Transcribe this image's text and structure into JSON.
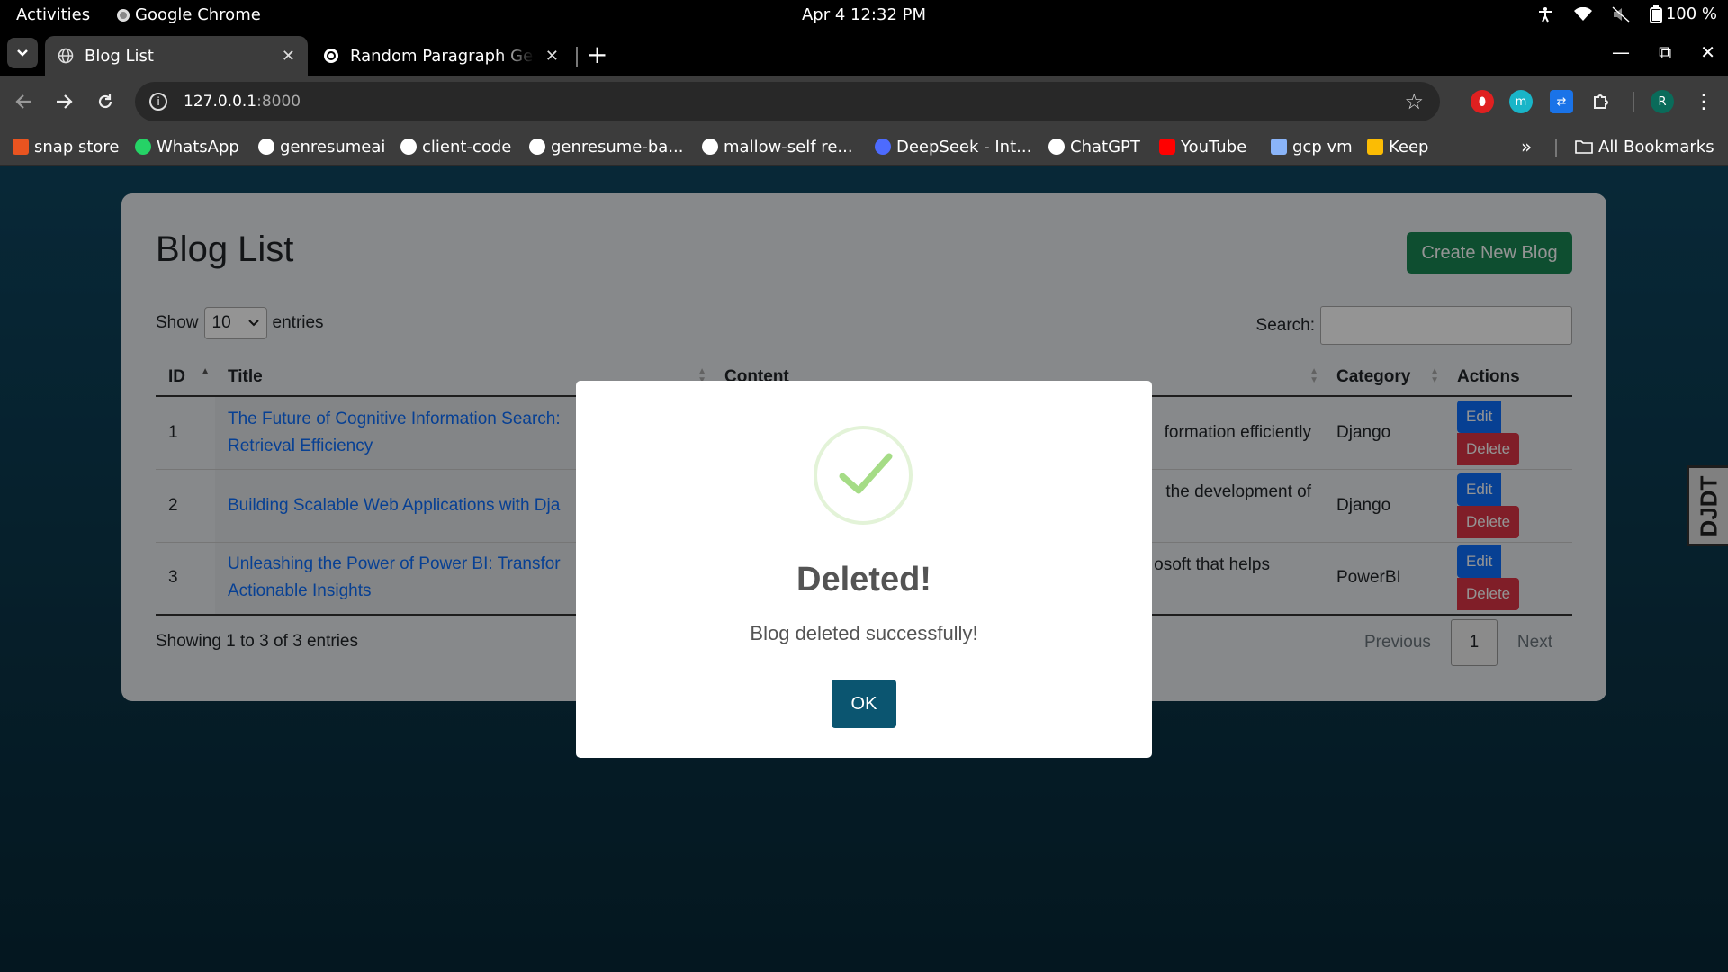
{
  "os": {
    "activities": "Activities",
    "app_name": "Google Chrome",
    "clock": "Apr 4  12:32 PM",
    "battery": "100 %"
  },
  "browser": {
    "tabs": [
      {
        "label": "Blog List",
        "active": true
      },
      {
        "label": "Random Paragraph Gene",
        "active": false
      }
    ],
    "url_host": "127.0.0.1",
    "url_port": ":8000",
    "profile_initial": "R",
    "ext_initial": "m",
    "bookmarks": [
      {
        "label": "snap store",
        "icon": "snap-icon",
        "color": "#e95420"
      },
      {
        "label": "WhatsApp",
        "icon": "whatsapp-icon",
        "color": "#25d366"
      },
      {
        "label": "genresumeai",
        "icon": "github-icon",
        "color": "#ffffff"
      },
      {
        "label": "client-code",
        "icon": "github-icon",
        "color": "#ffffff"
      },
      {
        "label": "genresume-ba...",
        "icon": "github-icon",
        "color": "#ffffff"
      },
      {
        "label": "mallow-self re...",
        "icon": "github-icon",
        "color": "#ffffff"
      },
      {
        "label": "DeepSeek - Int...",
        "icon": "deepseek-icon",
        "color": "#4d6bfe"
      },
      {
        "label": "ChatGPT",
        "icon": "chatgpt-icon",
        "color": "#ffffff"
      },
      {
        "label": "YouTube",
        "icon": "youtube-icon",
        "color": "#ff0000"
      },
      {
        "label": "gcp vm",
        "icon": "gcp-icon",
        "color": "#8ab4f8"
      },
      {
        "label": "Keep",
        "icon": "keep-icon",
        "color": "#fbbc04"
      }
    ],
    "more_bookmarks": "»",
    "all_bookmarks": "All Bookmarks"
  },
  "page": {
    "title": "Blog List",
    "create_button": "Create New Blog",
    "show_label": "Show",
    "entries_value": "10",
    "entries_label": "entries",
    "search_label": "Search:",
    "columns": [
      "ID",
      "Title",
      "Content",
      "Category",
      "Actions"
    ],
    "rows": [
      {
        "id": "1",
        "title_l1": "The Future of Cognitive Information Search:",
        "title_l2": "Retrieval Efficiency",
        "content": "formation efficiently",
        "category": "Django"
      },
      {
        "id": "2",
        "title_l1": "Building Scalable Web Applications with Dja",
        "title_l2": "",
        "content": "the development of",
        "category": "Django"
      },
      {
        "id": "3",
        "title_l1": "Unleashing the Power of Power BI: Transfor",
        "title_l2": "Actionable Insights",
        "content": "osoft that helps",
        "category": "PowerBI"
      }
    ],
    "edit_label": "Edit",
    "delete_label": "Delete",
    "showing_info": "Showing 1 to 3 of 3 entries",
    "prev_label": "Previous",
    "current_page": "1",
    "next_label": "Next",
    "djdt_label": "DJDT"
  },
  "modal": {
    "title": "Deleted!",
    "message": "Blog deleted successfully!",
    "ok_label": "OK",
    "success_color": "#a5dc86"
  }
}
